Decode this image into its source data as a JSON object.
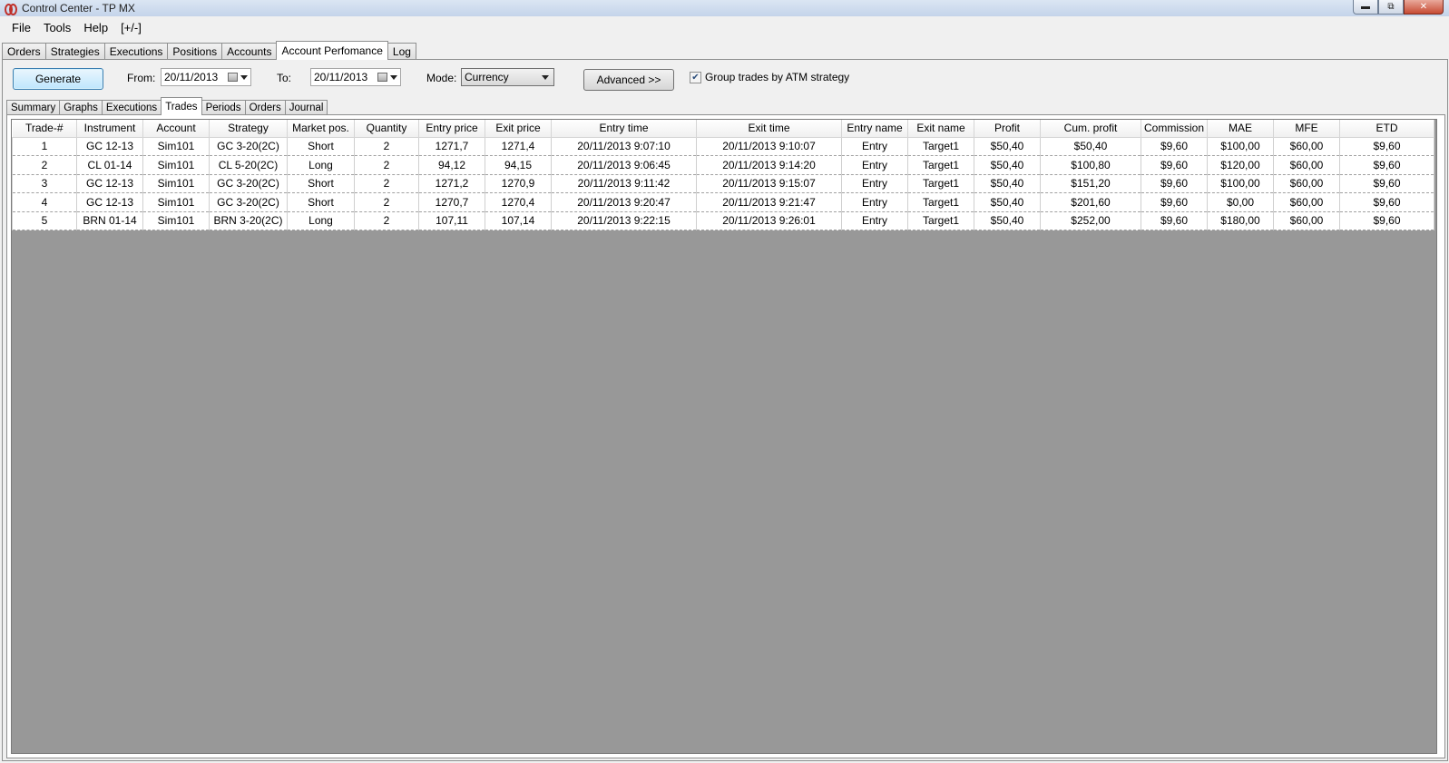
{
  "window": {
    "title": "Control Center - TP MX"
  },
  "menu": [
    "File",
    "Tools",
    "Help",
    "[+/-]"
  ],
  "outer_tabs": [
    {
      "label": "Orders",
      "active": false
    },
    {
      "label": "Strategies",
      "active": false
    },
    {
      "label": "Executions",
      "active": false
    },
    {
      "label": "Positions",
      "active": false
    },
    {
      "label": "Accounts",
      "active": false
    },
    {
      "label": "Account Perfomance",
      "active": true
    },
    {
      "label": "Log",
      "active": false
    }
  ],
  "controls": {
    "generate_label": "Generate",
    "from_label": "From:",
    "from_value": "20/11/2013",
    "to_label": "To:",
    "to_value": "20/11/2013",
    "mode_label": "Mode:",
    "mode_value": "Currency",
    "advanced_label": "Advanced >>",
    "group_checked": true,
    "group_label": "Group trades by ATM strategy"
  },
  "inner_tabs": [
    {
      "label": "Summary",
      "active": false
    },
    {
      "label": "Graphs",
      "active": false
    },
    {
      "label": "Executions",
      "active": false
    },
    {
      "label": "Trades",
      "active": true
    },
    {
      "label": "Periods",
      "active": false
    },
    {
      "label": "Orders",
      "active": false
    },
    {
      "label": "Journal",
      "active": false
    }
  ],
  "table": {
    "columns": [
      "Trade-#",
      "Instrument",
      "Account",
      "Strategy",
      "Market pos.",
      "Quantity",
      "Entry price",
      "Exit price",
      "Entry time",
      "Exit time",
      "Entry name",
      "Exit name",
      "Profit",
      "Cum. profit",
      "Commission",
      "MAE",
      "MFE",
      "ETD"
    ],
    "rows": [
      [
        "1",
        "GC 12-13",
        "Sim101",
        "GC 3-20(2C)",
        "Short",
        "2",
        "1271,7",
        "1271,4",
        "20/11/2013 9:07:10",
        "20/11/2013 9:10:07",
        "Entry",
        "Target1",
        "$50,40",
        "$50,40",
        "$9,60",
        "$100,00",
        "$60,00",
        "$9,60"
      ],
      [
        "2",
        "CL 01-14",
        "Sim101",
        "CL 5-20(2C)",
        "Long",
        "2",
        "94,12",
        "94,15",
        "20/11/2013 9:06:45",
        "20/11/2013 9:14:20",
        "Entry",
        "Target1",
        "$50,40",
        "$100,80",
        "$9,60",
        "$120,00",
        "$60,00",
        "$9,60"
      ],
      [
        "3",
        "GC 12-13",
        "Sim101",
        "GC 3-20(2C)",
        "Short",
        "2",
        "1271,2",
        "1270,9",
        "20/11/2013 9:11:42",
        "20/11/2013 9:15:07",
        "Entry",
        "Target1",
        "$50,40",
        "$151,20",
        "$9,60",
        "$100,00",
        "$60,00",
        "$9,60"
      ],
      [
        "4",
        "GC 12-13",
        "Sim101",
        "GC 3-20(2C)",
        "Short",
        "2",
        "1270,7",
        "1270,4",
        "20/11/2013 9:20:47",
        "20/11/2013 9:21:47",
        "Entry",
        "Target1",
        "$50,40",
        "$201,60",
        "$9,60",
        "$0,00",
        "$60,00",
        "$9,60"
      ],
      [
        "5",
        "BRN 01-14",
        "Sim101",
        "BRN 3-20(2C)",
        "Long",
        "2",
        "107,11",
        "107,14",
        "20/11/2013 9:22:15",
        "20/11/2013 9:26:01",
        "Entry",
        "Target1",
        "$50,40",
        "$252,00",
        "$9,60",
        "$180,00",
        "$60,00",
        "$9,60"
      ]
    ]
  }
}
